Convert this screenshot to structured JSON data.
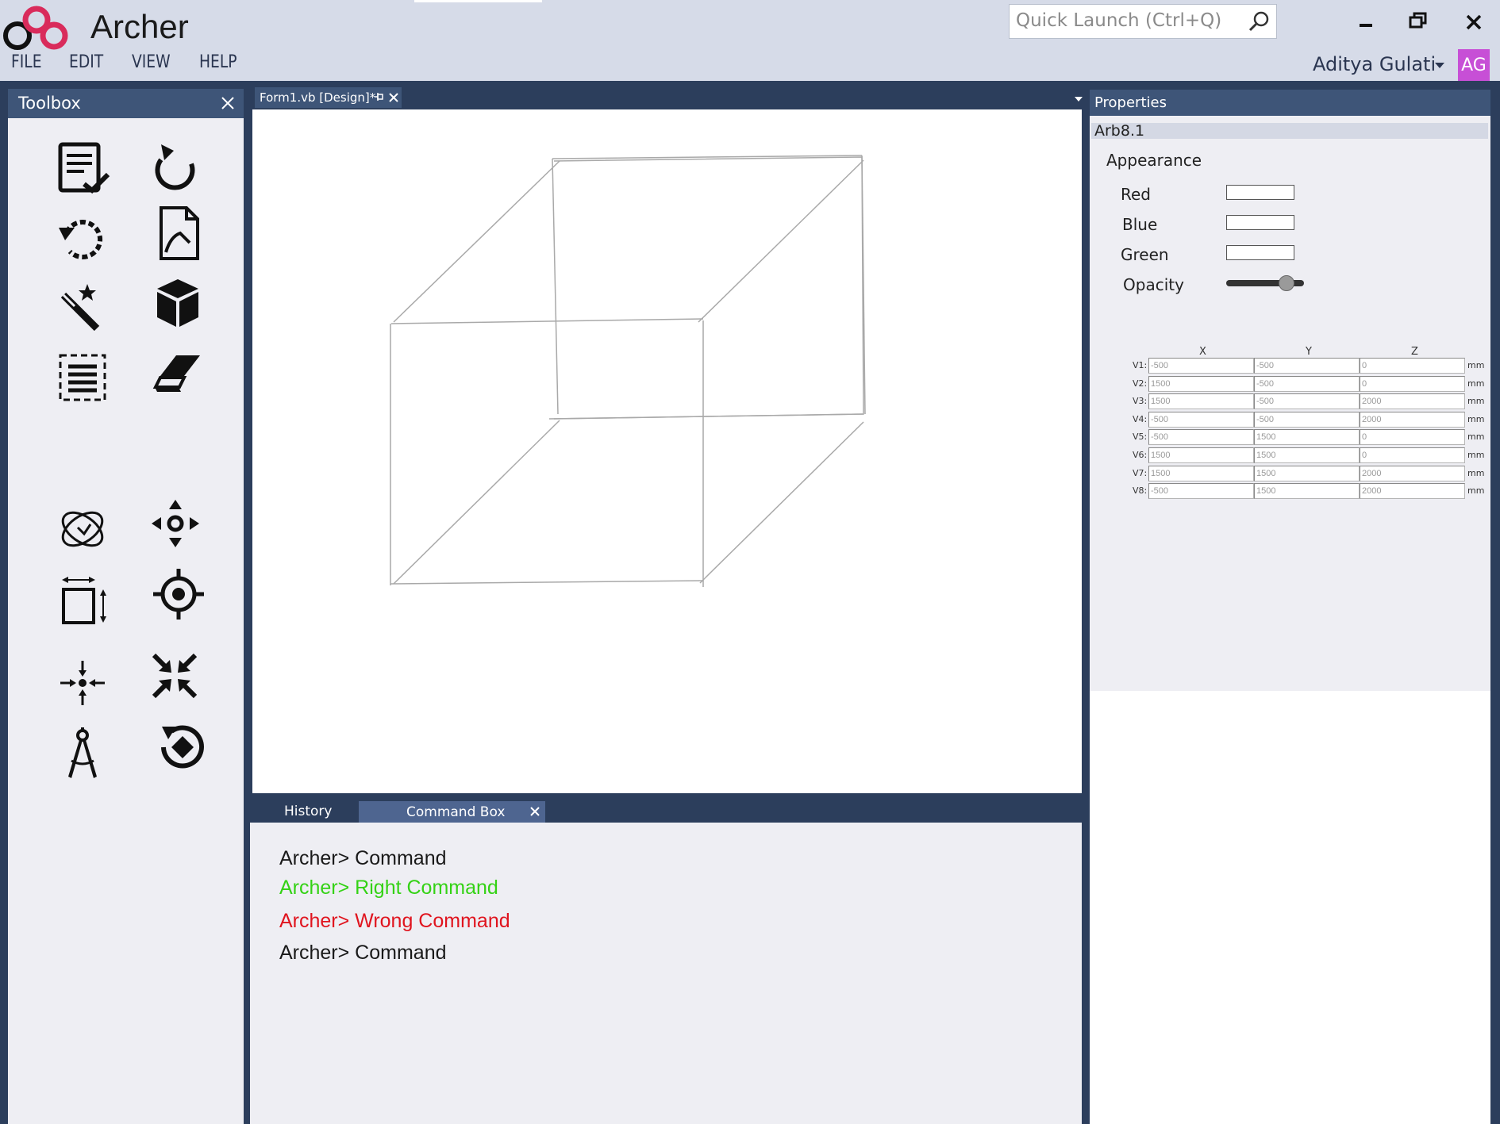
{
  "app": {
    "title": "Archer",
    "menu": [
      "FILE",
      "EDIT",
      "VIEW",
      "HELP"
    ],
    "quick_launch_placeholder": "Quick Launch (Ctrl+Q)",
    "user": {
      "name": "Aditya Gulati",
      "initials": "AG",
      "avatar_color": "#c74fd6"
    }
  },
  "toolbox": {
    "title": "Toolbox",
    "tools": [
      "checklist-icon",
      "redo-icon",
      "undo-icon",
      "edit-document-icon",
      "magic-wand-icon",
      "cube-icon",
      "select-lines-icon",
      "eraser-icon",
      "orbit-icon",
      "move-icon",
      "resize-icon",
      "target-icon",
      "center-icon",
      "compress-icon",
      "compass-icon",
      "rotate-point-icon"
    ]
  },
  "document": {
    "tab_label": "Form1.vb [Design]*"
  },
  "bottom_panel": {
    "tabs": [
      "History",
      "Command Box"
    ],
    "lines": [
      {
        "text": "Archer> Command",
        "color": "#1a1a1a"
      },
      {
        "text": "Archer> Right Command",
        "color": "#34d215"
      },
      {
        "text": "Archer> Wrong Command",
        "color": "#e0141e"
      },
      {
        "text": "Archer> Command",
        "color": "#1a1a1a"
      }
    ]
  },
  "properties": {
    "title": "Properties",
    "object": "Arb8.1",
    "section": "Appearance",
    "fields": [
      {
        "label": "Red",
        "value": ""
      },
      {
        "label": "Blue",
        "value": ""
      },
      {
        "label": "Green",
        "value": ""
      }
    ],
    "opacity_label": "Opacity",
    "opacity_value": 0.78,
    "vertex_headers": [
      "X",
      "Y",
      "Z"
    ],
    "unit": "mm",
    "vertices": [
      {
        "label": "V1:",
        "x": "-500",
        "y": "-500",
        "z": "0"
      },
      {
        "label": "V2:",
        "x": "1500",
        "y": "-500",
        "z": "0"
      },
      {
        "label": "V3:",
        "x": "1500",
        "y": "-500",
        "z": "2000"
      },
      {
        "label": "V4:",
        "x": "-500",
        "y": "-500",
        "z": "2000"
      },
      {
        "label": "V5:",
        "x": "-500",
        "y": "1500",
        "z": "0"
      },
      {
        "label": "V6:",
        "x": "1500",
        "y": "1500",
        "z": "0"
      },
      {
        "label": "V7:",
        "x": "1500",
        "y": "1500",
        "z": "2000"
      },
      {
        "label": "V8:",
        "x": "-500",
        "y": "1500",
        "z": "2000"
      }
    ]
  }
}
